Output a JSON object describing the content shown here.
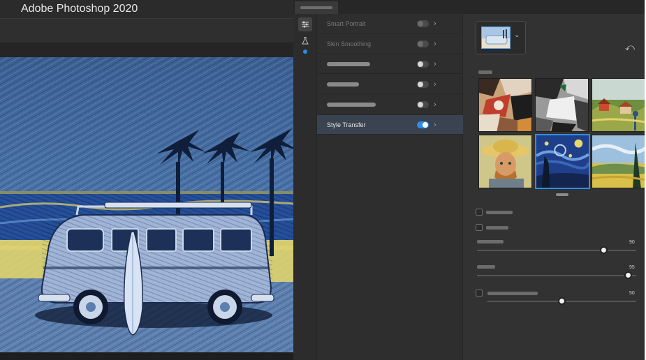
{
  "app": {
    "title": "Adobe Photoshop 2020"
  },
  "filters": [
    {
      "label": "Smart Portrait",
      "enabled": false,
      "selected": false
    },
    {
      "label": "Skin Smoothing",
      "enabled": false,
      "selected": false
    },
    {
      "label": "",
      "enabled": false,
      "selected": false
    },
    {
      "label": "",
      "enabled": false,
      "selected": false
    },
    {
      "label": "",
      "enabled": false,
      "selected": false
    },
    {
      "label": "Style Transfer",
      "enabled": true,
      "selected": true
    }
  ],
  "style_transfer": {
    "selected_style_index": 4,
    "styles": [
      {
        "icon": "abstract-cubist-painting"
      },
      {
        "icon": "abstract-monochrome-painting"
      },
      {
        "icon": "village-landscape-painting"
      },
      {
        "icon": "self-portrait-straw-hat"
      },
      {
        "icon": "starry-night-painting"
      },
      {
        "icon": "wheat-field-cypress-painting"
      }
    ],
    "sliders": [
      {
        "value": "90",
        "level": 0.8
      },
      {
        "value": "95",
        "level": 0.95
      },
      {
        "value": "50",
        "level": 0.5
      }
    ]
  },
  "icons": {
    "filters": "sliders-icon",
    "beta": "flask-icon",
    "reset": "reset-icon",
    "chevron": "chevron-right-icon"
  },
  "colors": {
    "accent": "#2f8de4",
    "panel": "#323232"
  }
}
